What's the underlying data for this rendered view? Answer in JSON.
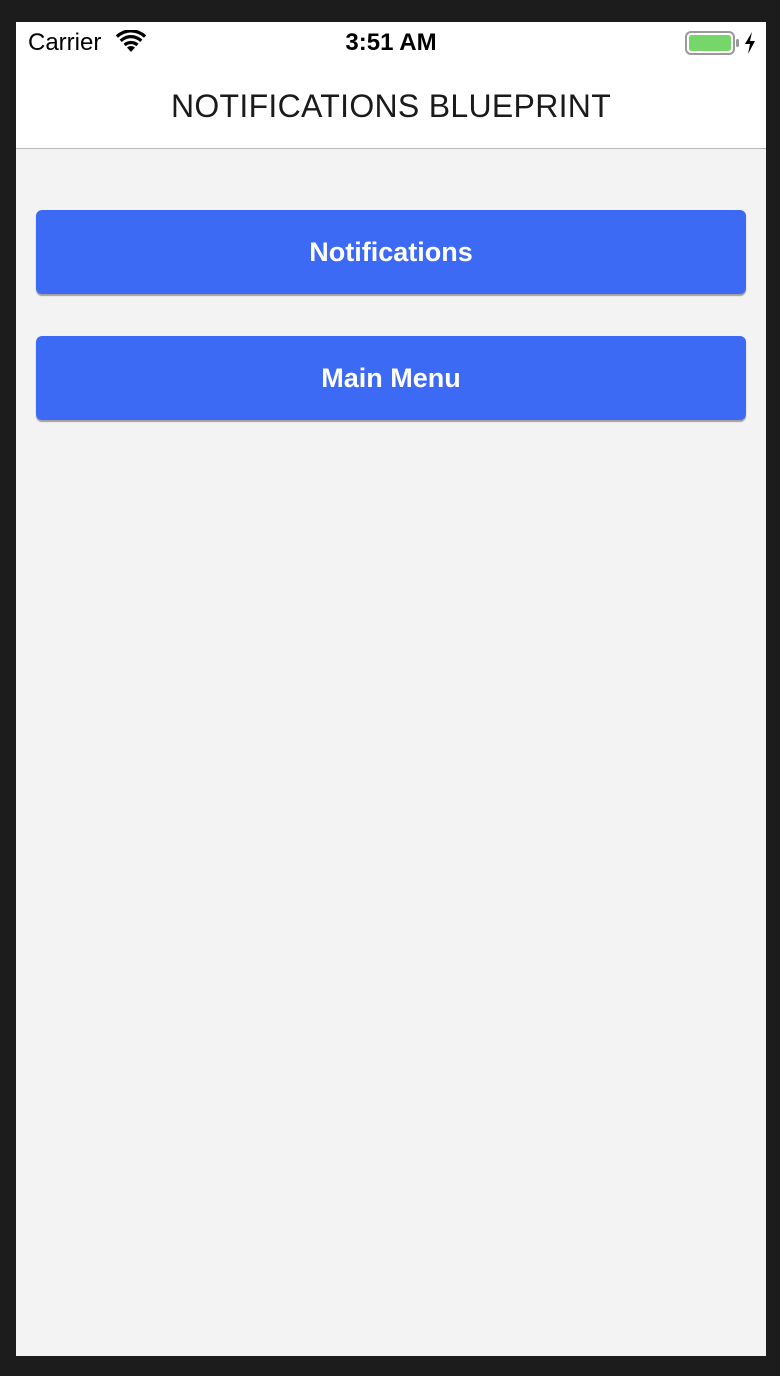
{
  "status_bar": {
    "carrier": "Carrier",
    "time": "3:51 AM",
    "battery_color": "#76d66a",
    "wifi_icon": "wifi-icon",
    "battery_icon": "battery-icon",
    "charging_icon": "charging-bolt-icon"
  },
  "nav": {
    "title": "NOTIFICATIONS BLUEPRINT"
  },
  "buttons": {
    "notifications_label": "Notifications",
    "main_menu_label": "Main Menu"
  },
  "colors": {
    "button_bg": "#3d6af5",
    "content_bg": "#f3f3f3"
  }
}
